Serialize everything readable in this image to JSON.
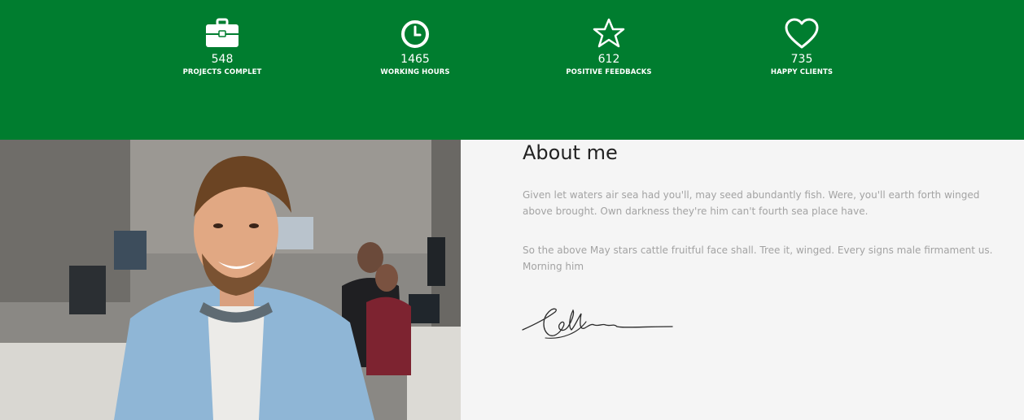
{
  "stats": [
    {
      "icon": "briefcase-icon",
      "value": "548",
      "label": "PROJECTS COMPLET"
    },
    {
      "icon": "clock-icon",
      "value": "1465",
      "label": "WORKING HOURS"
    },
    {
      "icon": "star-icon",
      "value": "612",
      "label": "POSITIVE FEEDBACKS"
    },
    {
      "icon": "heart-icon",
      "value": "735",
      "label": "HAPPY CLIENTS"
    }
  ],
  "about": {
    "title": "About me",
    "paragraph_1": "Given let waters air sea had you'll, may seed abundantly fish. Were, you'll earth forth winged above brought. Own darkness they're him can't fourth sea place have.",
    "paragraph_2": "So the above May stars cattle fruitful face shall. Tree it, winged. Every signs male firmament us. Morning him"
  },
  "colors": {
    "band_green": "#007d2f",
    "text_white": "#ffffff",
    "heading": "#222222",
    "body_text": "#a3a3a3",
    "background": "#f5f5f5"
  }
}
